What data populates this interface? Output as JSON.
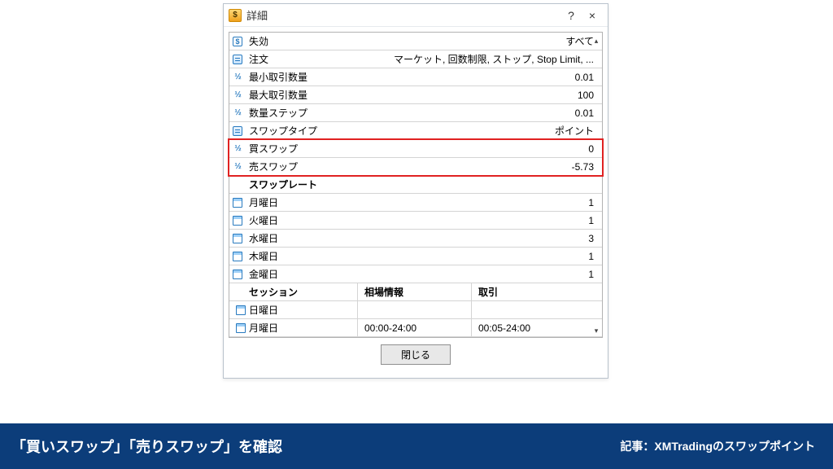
{
  "window": {
    "title": "詳細",
    "app_icon_letter": "$",
    "help_icon": "?",
    "close_icon": "×"
  },
  "rows": [
    {
      "icon": "dollar",
      "label": "失効",
      "value": "すべて"
    },
    {
      "icon": "doc",
      "label": "注文",
      "value": "マーケット, 回数制限, ストップ, Stop Limit, ..."
    },
    {
      "icon": "half",
      "label": "最小取引数量",
      "value": "0.01"
    },
    {
      "icon": "half",
      "label": "最大取引数量",
      "value": "100"
    },
    {
      "icon": "half",
      "label": "数量ステップ",
      "value": "0.01"
    },
    {
      "icon": "doc",
      "label": "スワップタイプ",
      "value": "ポイント"
    },
    {
      "icon": "half",
      "label": "買スワップ",
      "value": "0",
      "hl": true
    },
    {
      "icon": "half",
      "label": "売スワップ",
      "value": "-5.73",
      "hl": true
    }
  ],
  "swap_rate_header": "スワップレート",
  "swap_rate_days": [
    {
      "label": "月曜日",
      "value": "1"
    },
    {
      "label": "火曜日",
      "value": "1"
    },
    {
      "label": "水曜日",
      "value": "3"
    },
    {
      "label": "木曜日",
      "value": "1"
    },
    {
      "label": "金曜日",
      "value": "1"
    }
  ],
  "session": {
    "header": {
      "c1": "セッション",
      "c2": "相場情報",
      "c3": "取引"
    },
    "rows": [
      {
        "day": "日曜日",
        "quote": "",
        "trade": ""
      },
      {
        "day": "月曜日",
        "quote": "00:00-24:00",
        "trade": "00:05-24:00"
      }
    ]
  },
  "close_button": "閉じる",
  "banner": {
    "left": "「買いスワップ」「売りスワップ」を確認",
    "right": "記事：XMTradingのスワップポイント"
  }
}
